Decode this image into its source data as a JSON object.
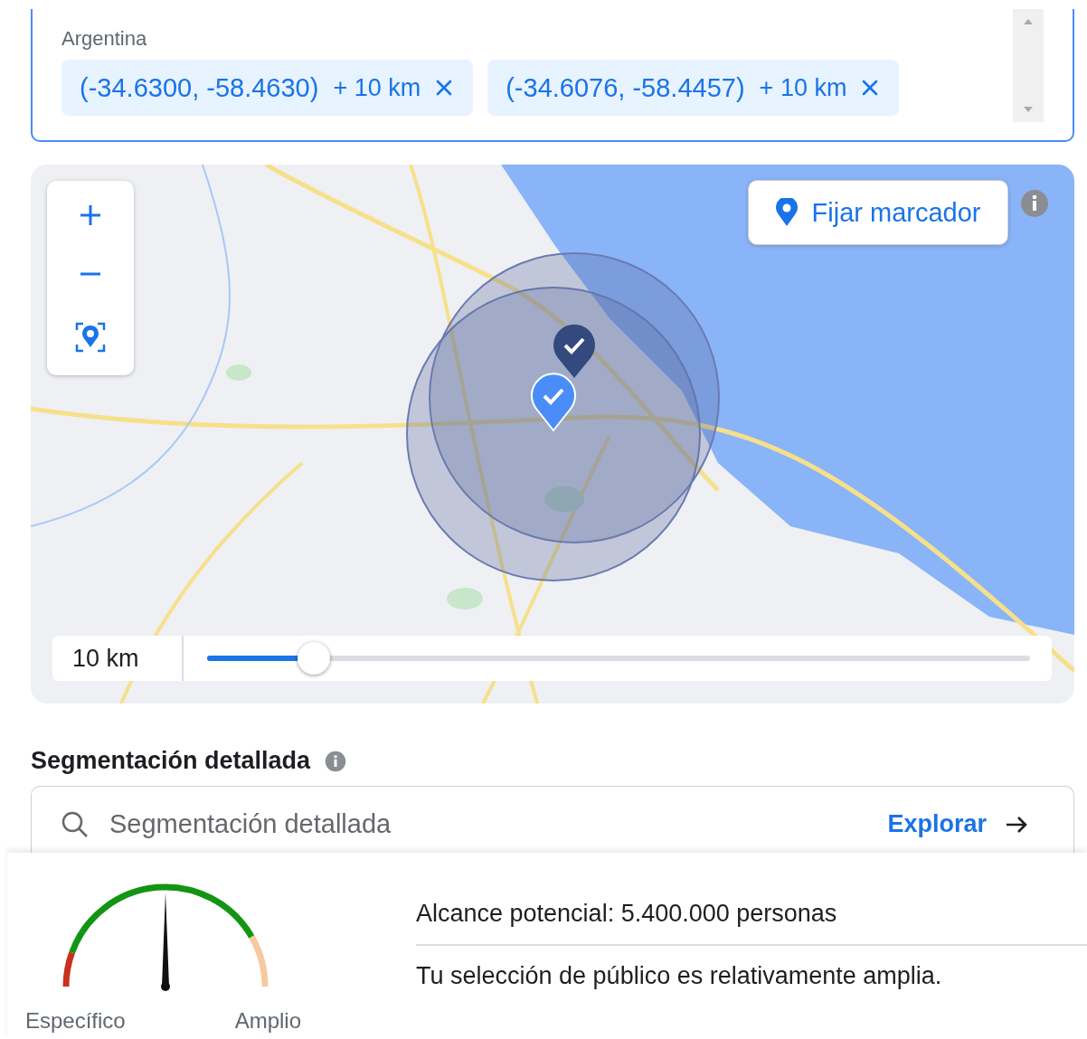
{
  "location_box": {
    "country": "Argentina",
    "chips": [
      {
        "coords": "(-34.6300, -58.4630)",
        "radius": "+ 10 km"
      },
      {
        "coords": "(-34.6076, -58.4457)",
        "radius": "+ 10 km"
      }
    ]
  },
  "map": {
    "pin_button": "Fijar marcador",
    "radius": {
      "label": "10 km",
      "level": 0.13
    }
  },
  "detailed_targeting": {
    "title": "Segmentación detallada",
    "search": {
      "placeholder": "Segmentación detallada"
    },
    "explore_link": "Explorar"
  },
  "audience": {
    "gauge": {
      "level": 0.5,
      "min_label": "Específico",
      "max_label": "Amplio"
    },
    "reach": "Alcance potencial: 5.400.000 personas",
    "description": "Tu selección de público es relativamente amplia."
  }
}
